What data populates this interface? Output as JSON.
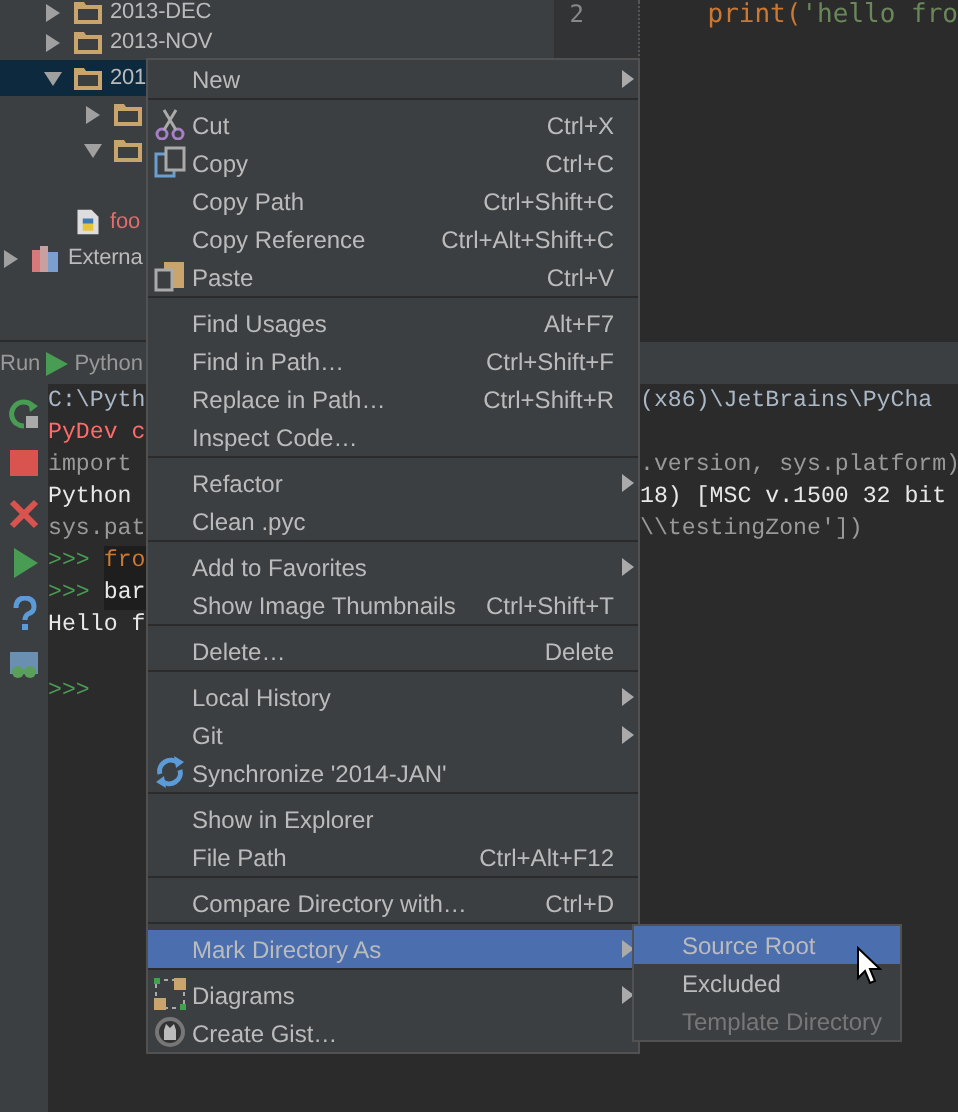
{
  "tree": {
    "items": [
      {
        "label": "2013-DEC",
        "kind": "folder",
        "expanded": false,
        "selected": false
      },
      {
        "label": "2013-NOV",
        "kind": "folder",
        "expanded": false,
        "selected": false
      },
      {
        "label": "201",
        "kind": "folder",
        "expanded": true,
        "selected": true,
        "children": [
          {
            "kind": "folder",
            "expanded": false,
            "selected": false
          },
          {
            "kind": "folder",
            "expanded": true,
            "selected": false
          }
        ]
      },
      {
        "kind": "spacer"
      },
      {
        "label": "foo",
        "kind": "file",
        "selected": false
      }
    ],
    "libraries": {
      "label": "Externa",
      "expanded": false
    }
  },
  "editor": {
    "line_number": "2",
    "code": [
      {
        "kind": "keyword",
        "text": "print("
      },
      {
        "kind": "string",
        "text": "'hello fro"
      }
    ]
  },
  "run_panel": {
    "label": "Run",
    "config": "Python",
    "console": [
      {
        "kind": "path",
        "text": "C:\\Pyth",
        "right": "(x86)\\JetBrains\\PyCha"
      },
      {
        "kind": "error",
        "text": "PyDev c"
      },
      {
        "kind": "code",
        "text": "import",
        "right": ".version, sys.platform)"
      },
      {
        "kind": "output",
        "text": "Python",
        "right": "18) [MSC v.1500 32 bit"
      },
      {
        "kind": "code",
        "text": "sys.pat",
        "right": "\\\\testingZone'])"
      },
      {
        "kind": "input",
        "prompt": ">>>",
        "text": "fro"
      },
      {
        "kind": "input",
        "prompt": ">>>",
        "text": "bar"
      },
      {
        "kind": "output",
        "text": "Hello f"
      },
      {
        "kind": "blank"
      },
      {
        "kind": "prompt",
        "prompt": ">>>"
      }
    ]
  },
  "context_menu": {
    "sections": [
      [
        {
          "label": "New",
          "submenu": true,
          "selected": false
        }
      ],
      [
        {
          "label": "Cut",
          "shortcut": "Ctrl+X",
          "kind": "cut",
          "selected": false
        },
        {
          "label": "Copy",
          "shortcut": "Ctrl+C",
          "kind": "copy",
          "selected": false
        },
        {
          "label": "Copy Path",
          "shortcut": "Ctrl+Shift+C",
          "selected": false
        },
        {
          "label": "Copy Reference",
          "shortcut": "Ctrl+Alt+Shift+C",
          "selected": false
        },
        {
          "label": "Paste",
          "shortcut": "Ctrl+V",
          "kind": "paste",
          "selected": false
        }
      ],
      [
        {
          "label": "Find Usages",
          "shortcut": "Alt+F7",
          "selected": false
        },
        {
          "label": "Find in Path…",
          "shortcut": "Ctrl+Shift+F",
          "selected": false
        },
        {
          "label": "Replace in Path…",
          "shortcut": "Ctrl+Shift+R",
          "selected": false
        },
        {
          "label": "Inspect Code…",
          "selected": false
        }
      ],
      [
        {
          "label": "Refactor",
          "submenu": true,
          "selected": false
        },
        {
          "label": "Clean .pyc",
          "selected": false
        }
      ],
      [
        {
          "label": "Add to Favorites",
          "submenu": true,
          "selected": false
        },
        {
          "label": "Show Image Thumbnails",
          "shortcut": "Ctrl+Shift+T",
          "selected": false
        }
      ],
      [
        {
          "label": "Delete…",
          "shortcut": "Delete",
          "selected": false
        }
      ],
      [
        {
          "label": "Local History",
          "submenu": true,
          "selected": false
        },
        {
          "label": "Git",
          "submenu": true,
          "selected": false
        },
        {
          "label": "Synchronize '2014-JAN'",
          "kind": "sync",
          "selected": false
        }
      ],
      [
        {
          "label": "Show in Explorer",
          "selected": false
        },
        {
          "label": "File Path",
          "shortcut": "Ctrl+Alt+F12",
          "selected": false
        }
      ],
      [
        {
          "label": "Compare Directory with…",
          "shortcut": "Ctrl+D",
          "selected": false
        }
      ],
      [
        {
          "label": "Mark Directory As",
          "submenu": true,
          "selected": true
        }
      ],
      [
        {
          "label": "Diagrams",
          "submenu": true,
          "kind": "diagrams",
          "selected": false
        },
        {
          "label": "Create Gist…",
          "kind": "gist",
          "selected": false
        }
      ]
    ]
  },
  "submenu": {
    "items": [
      {
        "label": "Source Root",
        "selected": true,
        "disabled": false
      },
      {
        "label": "Excluded",
        "selected": false,
        "disabled": false
      },
      {
        "label": "Template Directory",
        "selected": false,
        "disabled": true
      }
    ]
  }
}
